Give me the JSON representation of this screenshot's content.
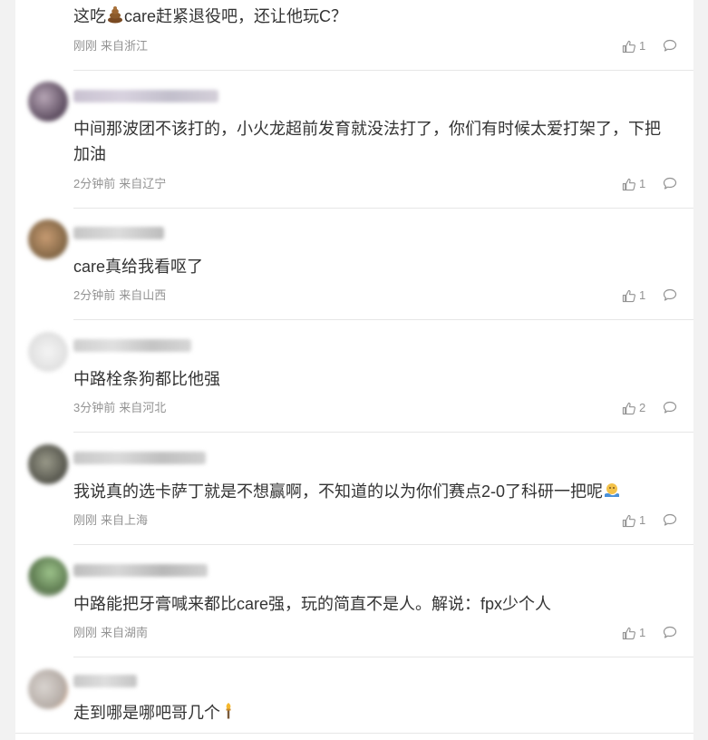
{
  "colors": {
    "background": "#f2f2f2",
    "card": "#ffffff",
    "text": "#333333",
    "meta": "#939393",
    "divider": "#e6e6e6"
  },
  "comments": [
    {
      "text_before": "这吃",
      "emoji": "poop-emoji",
      "text_after": "care赶紧退役吧，还让他玩C？",
      "time": "刚刚",
      "location": "来自浙江",
      "likes": "1"
    },
    {
      "text": "中间那波团不该打的，小火龙超前发育就没法打了，你们有时候太爱打架了，下把加油",
      "time": "2分钟前",
      "location": "来自辽宁",
      "likes": "1"
    },
    {
      "text": "care真给我看呕了",
      "time": "2分钟前",
      "location": "来自山西",
      "likes": "1"
    },
    {
      "text": "中路栓条狗都比他强",
      "time": "3分钟前",
      "location": "来自河北",
      "likes": "2"
    },
    {
      "text": "我说真的选卡萨丁就是不想赢啊，不知道的以为你们赛点2-0了科研一把呢",
      "emoji": "swimming-emoji",
      "time": "刚刚",
      "location": "来自上海",
      "likes": "1"
    },
    {
      "text": "中路能把牙膏喊来都比care强，玩的简直不是人。解说：fpx少个人",
      "time": "刚刚",
      "location": "来自湖南",
      "likes": "1"
    },
    {
      "text": "走到哪是哪吧哥几个",
      "emoji": "torch-emoji"
    }
  ]
}
